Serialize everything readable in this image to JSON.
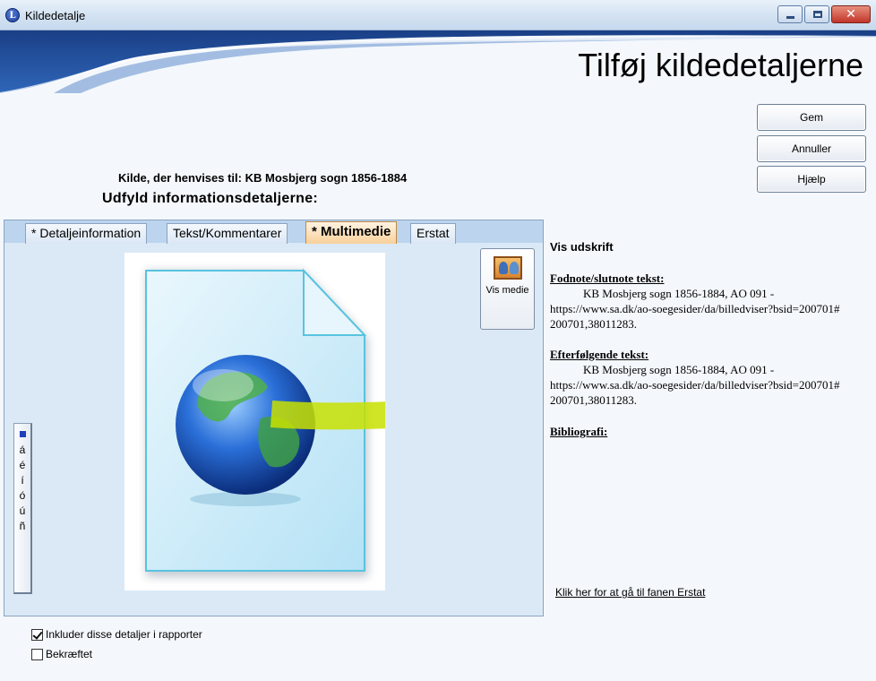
{
  "window": {
    "title": "Kildedetalje",
    "app_icon_letter": "L"
  },
  "header": {
    "heading": "Tilføj kildedetaljerne"
  },
  "actions": {
    "save": "Gem",
    "cancel": "Annuller",
    "help": "Hjælp"
  },
  "source": {
    "line": "Kilde, der henvises til: KB Mosbjerg sogn 1856-1884",
    "prompt": "Udfyld informationsdetaljerne:"
  },
  "tabs": [
    {
      "label": "* Detaljeinformation",
      "active": false
    },
    {
      "label": "Tekst/Kommentarer",
      "active": false
    },
    {
      "label": "* Multimedie",
      "active": true
    },
    {
      "label": "Erstat",
      "active": false
    }
  ],
  "media": {
    "view_button": "Vis medie"
  },
  "accent_chars": [
    "á",
    "é",
    "í",
    "ó",
    "ú",
    "ñ"
  ],
  "print_preview": {
    "title": "Vis udskrift",
    "footnote_heading": "Fodnote/slutnote tekst:",
    "footnote_line1": "KB Mosbjerg sogn 1856-1884, AO 091 -",
    "footnote_line2": "https://www.sa.dk/ao-soegesider/da/billedviser?bsid=200701#",
    "footnote_line3": "200701,38011283.",
    "subsequent_heading": "Efterfølgende tekst:",
    "subsequent_line1": "KB Mosbjerg sogn 1856-1884, AO 091 -",
    "subsequent_line2": "https://www.sa.dk/ao-soegesider/da/billedviser?bsid=200701#",
    "subsequent_line3": "200701,38011283.",
    "bibliography_heading": "Bibliografi:"
  },
  "replace_link": "Klik her for at gå til fanen Erstat",
  "options": {
    "include_label": "Inkluder disse detaljer i rapporter",
    "include_checked": true,
    "confirmed_label": "Bekræftet",
    "confirmed_checked": false
  }
}
